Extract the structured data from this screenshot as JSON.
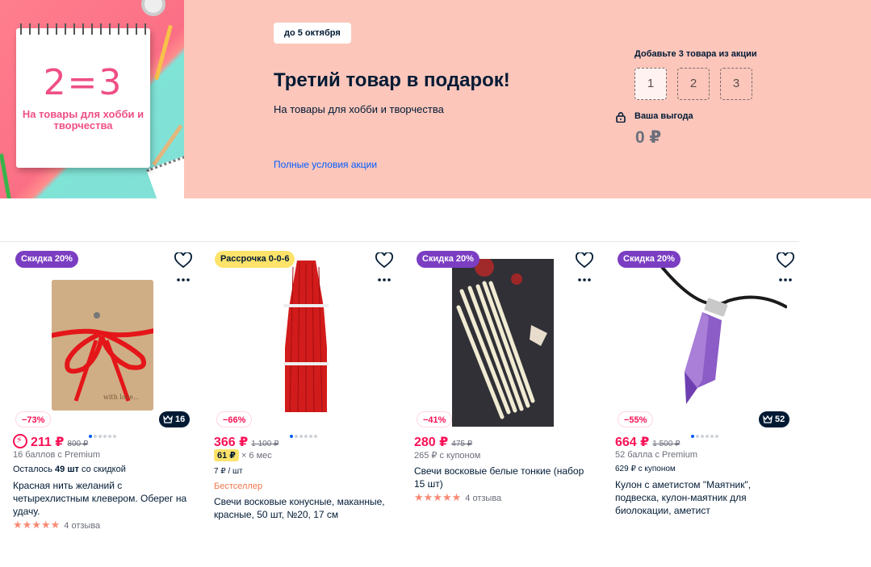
{
  "banner": {
    "art_equation": "2=3",
    "art_subtitle": "На товары для хобби и творчества",
    "deadline": "до 5 октября",
    "title": "Третий товар в подарок!",
    "subtitle": "На товары для хобби и творчества",
    "terms_link": "Полные условия акции",
    "add_title": "Добавьте 3 товара из акции",
    "slots": [
      "1",
      "2",
      "3"
    ],
    "benefit_label": "Ваша выгода",
    "benefit_value": "0 ₽"
  },
  "colors": {
    "accent_price": "#f91155",
    "sale_badge": "#7b3ec2",
    "install_badge": "#fde36a",
    "link": "#005bff",
    "banner_bg": "#fcc6bb"
  },
  "products": [
    {
      "badge": "Скидка 20%",
      "discount": "−73%",
      "crown_count": "16",
      "price": "211 ₽",
      "old_price": "800 ₽",
      "note1": "16 баллов с Premium",
      "stock_prefix": "Осталось ",
      "stock_count": "49 шт",
      "stock_suffix": " со скидкой",
      "title": "Красная нить желаний с четырехлистным клевером. Оберег на удачу.",
      "reviews": "4 отзыва"
    },
    {
      "badge": "Рассрочка 0-0-6",
      "discount": "−66%",
      "price": "366 ₽",
      "old_price": "1 100 ₽",
      "installment_price": "61 ₽",
      "installment_term": "× 6 мес",
      "per_unit": "7 ₽ / шт",
      "bestseller": "Бестселлер",
      "title": "Свечи восковые конусные, маканные, красные, 50 шт, №20, 17 см"
    },
    {
      "badge": "Скидка 20%",
      "discount": "−41%",
      "price": "280 ₽",
      "old_price": "475 ₽",
      "note1": "265 ₽ с купоном",
      "title": "Свечи восковые белые тонкие (набор 15 шт)",
      "reviews": "4 отзыва"
    },
    {
      "badge": "Скидка 20%",
      "discount": "−55%",
      "crown_count": "52",
      "price": "664 ₽",
      "old_price": "1 500 ₽",
      "note1": "52 балла с Premium",
      "note2": "629 ₽ с купоном",
      "title": "Кулон с аметистом \"Маятник\", подвеска, кулон-маятник для биолокации, аметист"
    }
  ]
}
